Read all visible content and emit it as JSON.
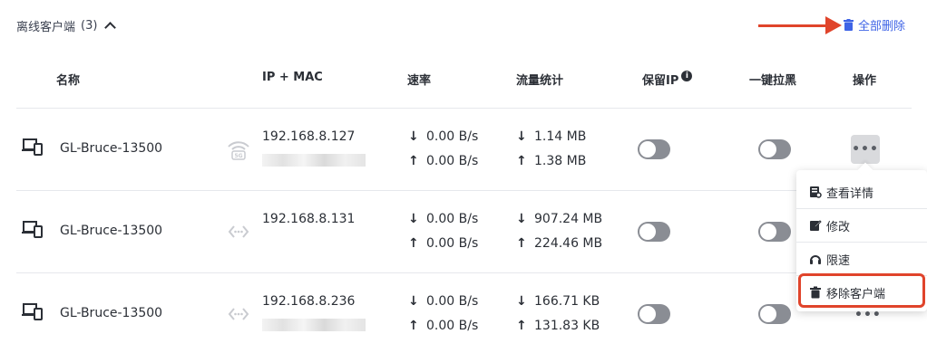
{
  "section": {
    "title": "离线客户端",
    "count": "(3)"
  },
  "actions": {
    "delete_all": "全部删除"
  },
  "columns": {
    "name": "名称",
    "ip_mac": "IP + MAC",
    "rate": "速率",
    "traffic": "流量统计",
    "keep_ip": "保留IP",
    "block": "一键拉黑",
    "operation": "操作"
  },
  "rows": [
    {
      "name": "GL-Bruce-13500",
      "ip": "192.168.8.127",
      "rate_down": "0.00 B/s",
      "rate_up": "0.00 B/s",
      "traffic_down": "1.14 MB",
      "traffic_up": "1.38 MB",
      "connection": "wifi-5g-icon",
      "keep_ip": false,
      "block": false
    },
    {
      "name": "GL-Bruce-13500",
      "ip": "192.168.8.131",
      "rate_down": "0.00 B/s",
      "rate_up": "0.00 B/s",
      "traffic_down": "907.24 MB",
      "traffic_up": "224.46 MB",
      "connection": "ethernet-icon",
      "keep_ip": false,
      "block": false
    },
    {
      "name": "GL-Bruce-13500",
      "ip": "192.168.8.236",
      "rate_down": "0.00 B/s",
      "rate_up": "0.00 B/s",
      "traffic_down": "166.71 KB",
      "traffic_up": "131.83 KB",
      "connection": "ethernet-icon",
      "keep_ip": false,
      "block": false
    }
  ],
  "menu": {
    "view_details": "查看详情",
    "edit": "修改",
    "limit_speed": "限速",
    "remove_client": "移除客户端"
  },
  "icons": {
    "arrow_down": "↓",
    "arrow_up": "↑",
    "more": "•••"
  },
  "colors": {
    "accent": "#3f64e6",
    "annotation": "#e0442b",
    "toggle_off": "#8a8d94"
  }
}
